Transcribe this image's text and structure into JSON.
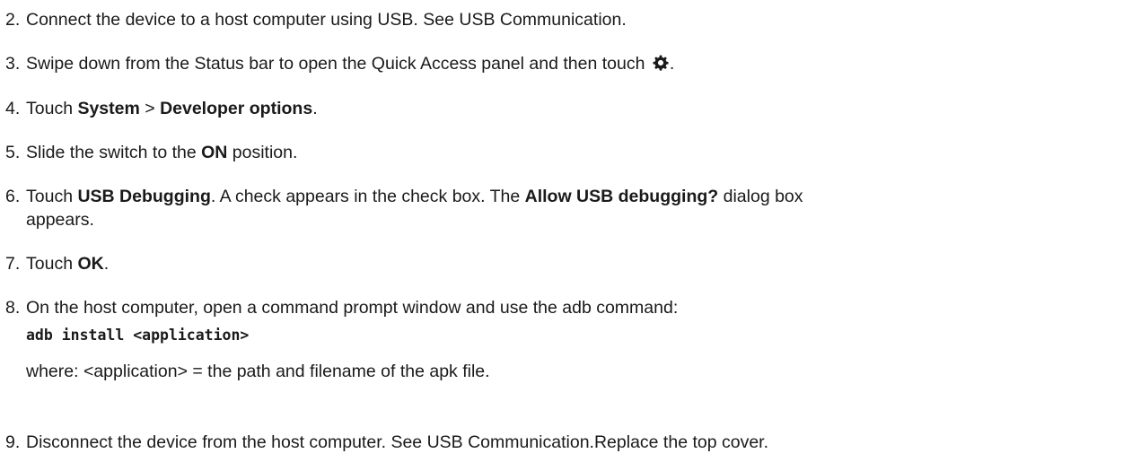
{
  "steps": [
    {
      "number": "2.",
      "text": "Connect the device to a host computer using USB. See USB Communication."
    },
    {
      "number": "3.",
      "text": "Swipe down from the Status bar to open the Quick Access panel and then touch",
      "icon": "gear-icon",
      "end": "."
    },
    {
      "number": "4.",
      "pre": "Touch ",
      "bold1": "System",
      "mid": " > ",
      "bold2": "Developer options",
      "end": "."
    },
    {
      "number": "5.",
      "pre": "Slide the switch to the ",
      "bold": "ON",
      "post": " position."
    },
    {
      "number": "6.",
      "pre": "Touch ",
      "bold1": "USB Debugging",
      "mid": ". A check appears in the check box. The ",
      "bold2": "Allow USB debugging?",
      "post": " dialog box",
      "line2": "appears."
    },
    {
      "number": "7.",
      "pre": "Touch ",
      "bold": "OK",
      "end": "."
    },
    {
      "number": "8.",
      "text": "On the host computer, open a command prompt window and use the adb command:",
      "code": "adb install <application>",
      "where": "where: <application> = the path and filename of the apk file."
    },
    {
      "number": "9.",
      "text": "Disconnect the device from the host computer. See USB Communication.Replace the top cover."
    }
  ]
}
